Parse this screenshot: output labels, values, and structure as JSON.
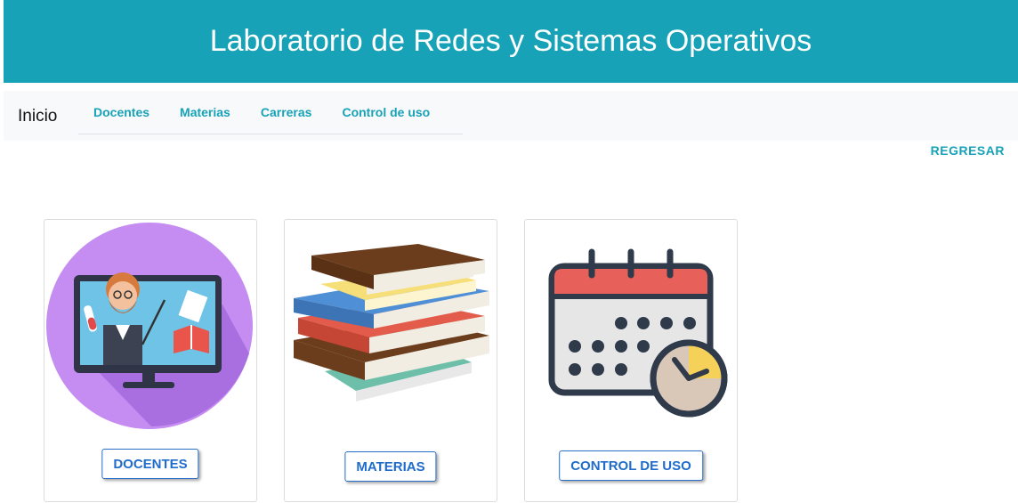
{
  "header": {
    "title": "Laboratorio de Redes y Sistemas Operativos"
  },
  "navbar": {
    "brand": "Inicio",
    "links": [
      "Docentes",
      "Materias",
      "Carreras",
      "Control de uso"
    ]
  },
  "back_link": "REGRESAR",
  "cards": [
    {
      "button": "DOCENTES",
      "icon": "teacher-monitor-illustration"
    },
    {
      "button": "MATERIAS",
      "icon": "book-stack-illustration"
    },
    {
      "button": "CONTROL DE USO",
      "icon": "calendar-clock-icon"
    }
  ],
  "colors": {
    "accent": "#17a2b8",
    "button_text": "#1f6ccc"
  }
}
